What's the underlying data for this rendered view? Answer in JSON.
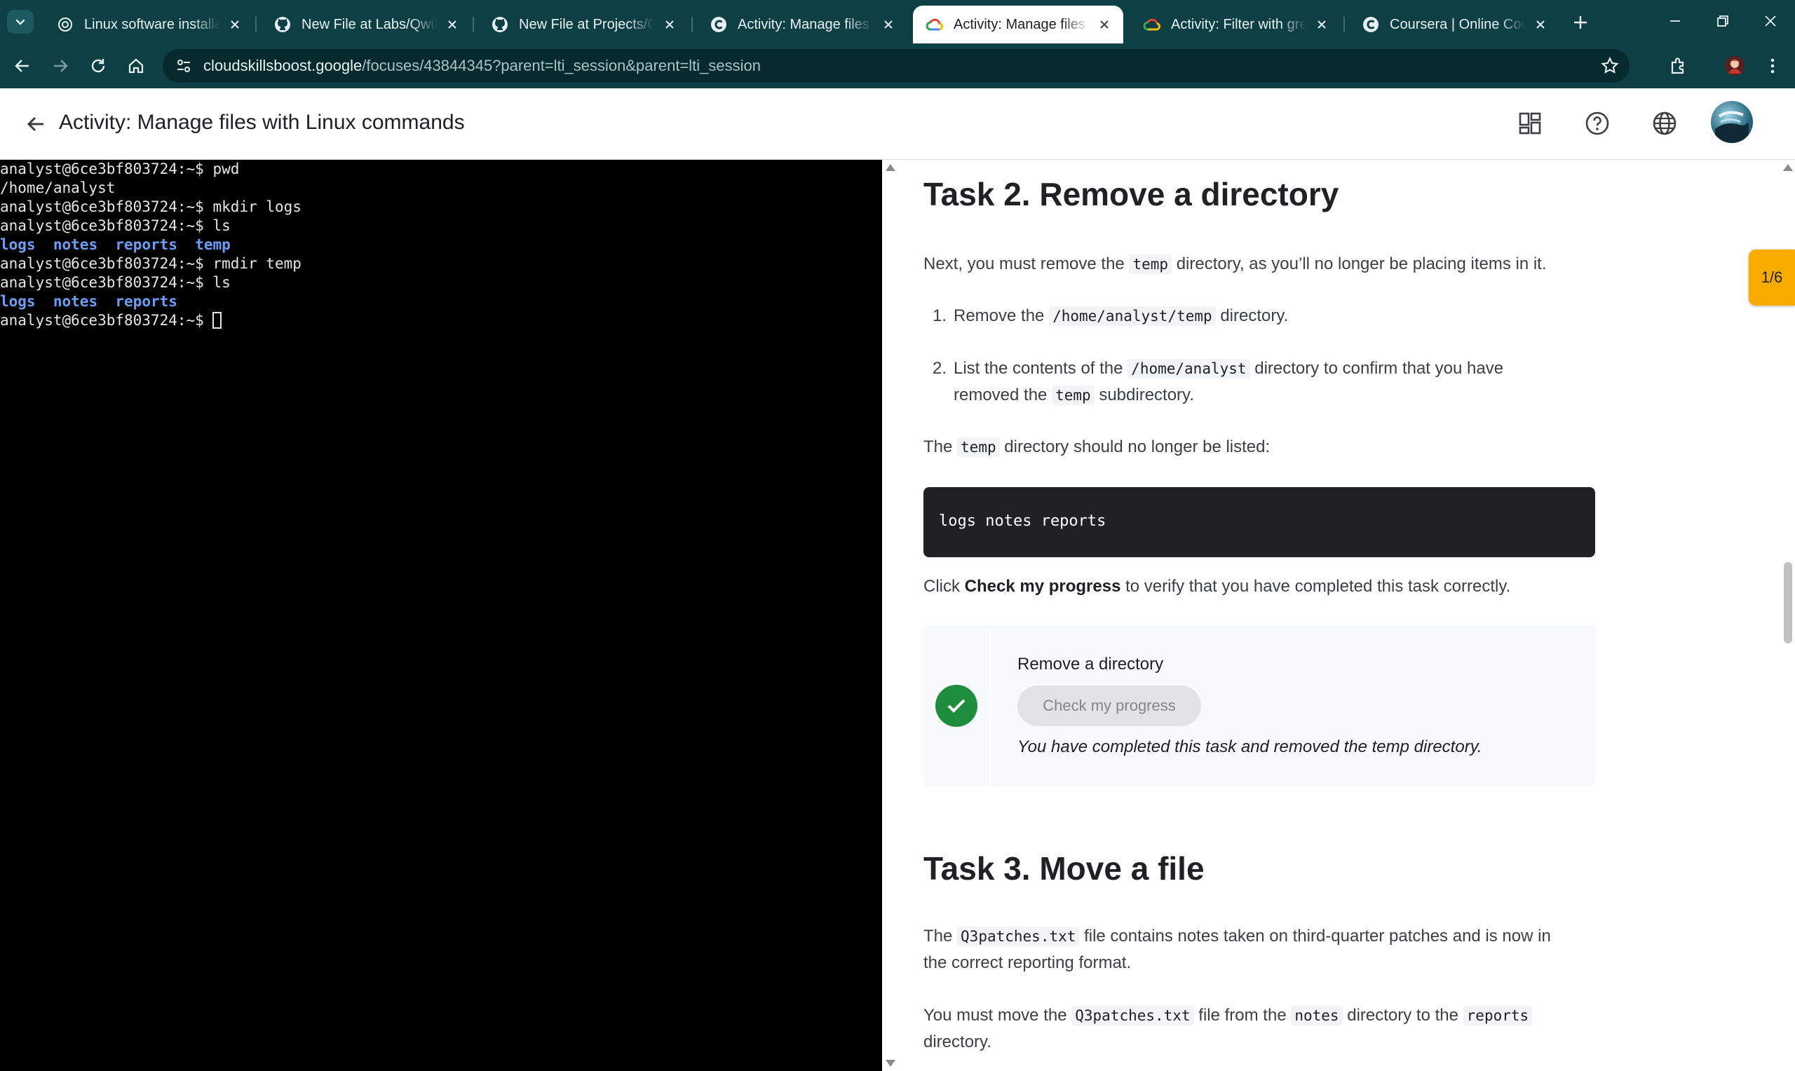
{
  "browser": {
    "tabs": [
      {
        "title": "Linux software installation",
        "icon": "openai-icon",
        "active": false
      },
      {
        "title": "New File at Labs/Qwiklabs",
        "icon": "github-icon",
        "active": false
      },
      {
        "title": "New File at Projects/Google",
        "icon": "github-icon",
        "active": false
      },
      {
        "title": "Activity: Manage files with",
        "icon": "coursera-icon",
        "active": false
      },
      {
        "title": "Activity: Manage files with",
        "icon": "google-cloud-icon",
        "active": true
      },
      {
        "title": "Activity: Filter with grep |",
        "icon": "google-cloud-icon",
        "active": false
      },
      {
        "title": "Coursera | Online Courses",
        "icon": "coursera-icon",
        "active": false
      }
    ],
    "url_host": "cloudskillsboost.google",
    "url_path": "/focuses/43844345?parent=lti_session&parent=lti_session"
  },
  "header": {
    "title": "Activity: Manage files with Linux commands"
  },
  "terminal": {
    "lines": [
      {
        "prompt": "analyst@6ce3bf803724:~$",
        "cmd": "pwd"
      },
      {
        "output": "/home/analyst"
      },
      {
        "prompt": "analyst@6ce3bf803724:~$",
        "cmd": "mkdir logs"
      },
      {
        "prompt": "analyst@6ce3bf803724:~$",
        "cmd": "ls"
      },
      {
        "dirs": [
          "logs",
          "notes",
          "reports",
          "temp"
        ]
      },
      {
        "prompt": "analyst@6ce3bf803724:~$",
        "cmd": "rmdir temp"
      },
      {
        "prompt": "analyst@6ce3bf803724:~$",
        "cmd": "ls"
      },
      {
        "dirs": [
          "logs",
          "notes",
          "reports"
        ]
      },
      {
        "prompt": "analyst@6ce3bf803724:~$",
        "cmd": "",
        "cursor": true
      }
    ]
  },
  "progress_tab": "1/6",
  "task2": {
    "heading": "Task 2. Remove a directory",
    "intro_a": "Next, you must remove the",
    "intro_code": "temp",
    "intro_b": "directory, as you’ll no longer be placing items in it.",
    "step1_a": "Remove the",
    "step1_code": "/home/analyst/temp",
    "step1_b": "directory.",
    "step2_a": "List the contents of the",
    "step2_code": "/home/analyst",
    "step2_b": "directory to confirm that you have",
    "step2_c": "removed the",
    "step2_code2": "temp",
    "step2_d": "subdirectory.",
    "note_a": "The",
    "note_code": "temp",
    "note_b": "directory should no longer be listed:",
    "code_block": "logs notes reports",
    "click_a": "Click",
    "click_bold": "Check my progress",
    "click_b": "to verify that you have completed this task correctly.",
    "check": {
      "title": "Remove a directory",
      "button": "Check my progress",
      "message": "You have completed this task and removed the temp directory."
    }
  },
  "task3": {
    "heading": "Task 3. Move a file",
    "p1_a": "The",
    "p1_code": "Q3patches.txt",
    "p1_b": "file contains notes taken on third-quarter patches and is now in",
    "p1_c": "the correct reporting format.",
    "p2_a": "You must move the",
    "p2_code": "Q3patches.txt",
    "p2_b": "file from the",
    "p2_code2": "notes",
    "p2_c": "directory to the",
    "p2_code3": "reports",
    "p2_d": "directory."
  }
}
